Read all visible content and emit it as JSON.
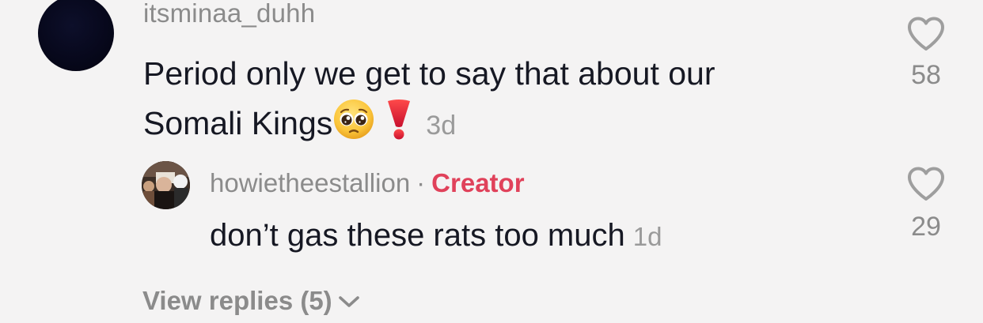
{
  "comment": {
    "username": "itsminaa_duhh",
    "text_line1": "Period only we get to say that about our",
    "text_line2": "Somali Kings",
    "timestamp": "3d",
    "like_count": "58",
    "emojis": [
      "pleading-face-emoji",
      "red-exclamation-emoji"
    ]
  },
  "reply": {
    "username": "howietheestallion",
    "separator": "·",
    "badge": "Creator",
    "text": "don’t gas these rats too much",
    "timestamp": "1d",
    "like_count": "29"
  },
  "view_replies": {
    "label": "View replies (5)"
  },
  "icons": {
    "like": "heart-outline-icon",
    "expand": "chevron-down-icon"
  },
  "colors": {
    "background": "#f4f3f3",
    "creator_badge": "#e0415a",
    "muted_text": "#8b8b8b",
    "primary_text": "#161823"
  }
}
